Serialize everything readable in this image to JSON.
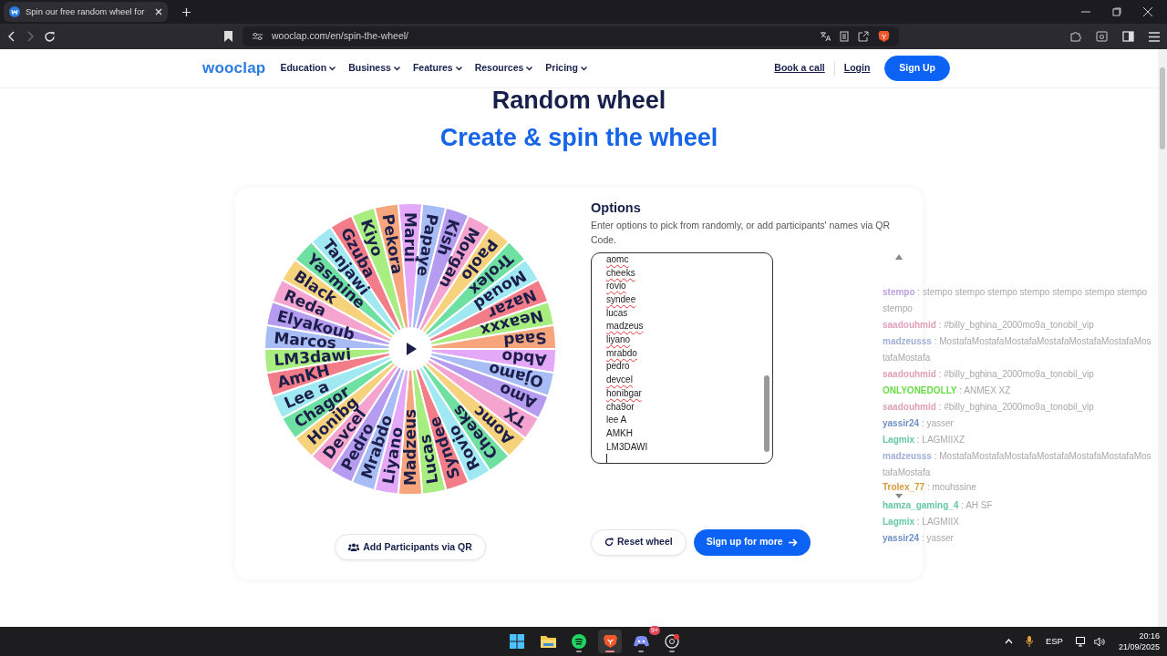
{
  "browser": {
    "tab_title": "Spin our free random wheel for",
    "url": "wooclap.com/en/spin-the-wheel/"
  },
  "site_nav": {
    "logo": "wooclap",
    "menu": [
      {
        "label": "Education"
      },
      {
        "label": "Business"
      },
      {
        "label": "Features"
      },
      {
        "label": "Resources"
      },
      {
        "label": "Pricing"
      }
    ],
    "book_call": "Book a call",
    "login": "Login",
    "signup": "Sign Up"
  },
  "hero": {
    "title": "Random wheel",
    "subtitle": "Create & spin the wheel"
  },
  "wheel": {
    "segments": [
      {
        "label": "Marui"
      },
      {
        "label": "Papaye"
      },
      {
        "label": "Kish"
      },
      {
        "label": "Morgan"
      },
      {
        "label": "Paolo"
      },
      {
        "label": "Trolex"
      },
      {
        "label": "Mouad"
      },
      {
        "label": "Nazar"
      },
      {
        "label": "Neaxxx"
      },
      {
        "label": "Saad"
      },
      {
        "label": "Abdo"
      },
      {
        "label": "Ojamo"
      },
      {
        "label": "Amo"
      },
      {
        "label": "TX"
      },
      {
        "label": "Aomc"
      },
      {
        "label": "Cheeks"
      },
      {
        "label": "Rovio"
      },
      {
        "label": "Syndee"
      },
      {
        "label": "Lucas"
      },
      {
        "label": "Madzeus"
      },
      {
        "label": "Liyano"
      },
      {
        "label": "Mrabdo"
      },
      {
        "label": "Pedro"
      },
      {
        "label": "Devcel"
      },
      {
        "label": "Honibg"
      },
      {
        "label": "Chagor"
      },
      {
        "label": "Lee a"
      },
      {
        "label": "AmKH"
      },
      {
        "label": "LM3dawi"
      },
      {
        "label": "Marcos"
      },
      {
        "label": "Elyakoub"
      },
      {
        "label": "Reda"
      },
      {
        "label": "Black"
      },
      {
        "label": "Yasmine"
      },
      {
        "label": "Tanjawi"
      },
      {
        "label": "Gzuba"
      },
      {
        "label": "Kiyo"
      },
      {
        "label": "Pekora"
      }
    ]
  },
  "options": {
    "title": "Options",
    "description": "Enter options to pick from randomly, or add participants' names via QR Code.",
    "entries": [
      {
        "text": "aomc",
        "misspelled": true
      },
      {
        "text": "cheeks",
        "misspelled": true
      },
      {
        "text": "rovio",
        "misspelled": true
      },
      {
        "text": "syndee",
        "misspelled": true
      },
      {
        "text": "lucas",
        "misspelled": false
      },
      {
        "text": "madzeus",
        "misspelled": true
      },
      {
        "text": "liyano",
        "misspelled": true
      },
      {
        "text": "mrabdo",
        "misspelled": true
      },
      {
        "text": "pedro",
        "misspelled": false
      },
      {
        "text": "devcel",
        "misspelled": true
      },
      {
        "text": "honibgar",
        "misspelled": true
      },
      {
        "text": "cha9or",
        "misspelled": false
      },
      {
        "text": "lee A",
        "misspelled": false
      },
      {
        "text": "AMKH",
        "misspelled": false
      },
      {
        "text": "LM3DAWI",
        "misspelled": false
      }
    ]
  },
  "buttons": {
    "add_qr": "Add Participants via QR",
    "reset": "Reset wheel",
    "signup_more": "Sign up for more"
  },
  "chat": [
    {
      "user": "stempo",
      "color": "#b9a0e0",
      "message": ": stempo stempo stempo stempo stempo stempo stempo stempo"
    },
    {
      "user": "saadouhmid",
      "color": "#e0a0b8",
      "message": ": #billy_bghina_2000mo9a_tonobil_vip"
    },
    {
      "user": "madzeusss",
      "color": "#9fb0d8",
      "message": ": MostafaMostafaMostafaMostafaMostafaMostafaMostafaMostafa"
    },
    {
      "user": "saadouhmid",
      "color": "#e0a0b8",
      "message": ": #billy_bghina_2000mo9a_tonobil_vip"
    },
    {
      "user": "ONLYONEDOLLY",
      "color": "#66dd44",
      "message": ": ANMEX XZ"
    },
    {
      "user": "saadouhmid",
      "color": "#e0a0b8",
      "message": ": #billy_bghina_2000mo9a_tonobil_vip"
    },
    {
      "user": "yassir24",
      "color": "#6f90c8",
      "message": ": yasser"
    },
    {
      "user": "Lagmix",
      "color": "#66c8a8",
      "message": ": LAGMIIXZ"
    },
    {
      "user": "madzeusss",
      "color": "#9fb0d8",
      "message": ": MostafaMostafaMostafaMostafaMostafaMostafaMostafaMostafa"
    },
    {
      "user": "Trolex_77",
      "color": "#d89a3a",
      "message": ": mouhssine"
    },
    {
      "user": "hamza_gaming_4",
      "color": "#66c8a8",
      "message": ": AH SF"
    },
    {
      "user": "Lagmix",
      "color": "#66c8a8",
      "message": ": LAGMIIX"
    },
    {
      "user": "yassir24",
      "color": "#6f90c8",
      "message": ": yasser"
    }
  ],
  "taskbar": {
    "apps": [
      {
        "kind": "start",
        "running": false,
        "selected": false
      },
      {
        "kind": "folder",
        "running": false,
        "selected": false
      },
      {
        "kind": "music",
        "running": true,
        "selected": false
      },
      {
        "kind": "lion",
        "running": true,
        "selected": true
      },
      {
        "kind": "chat",
        "running": true,
        "selected": false,
        "badge": "9+"
      },
      {
        "kind": "record",
        "running": true,
        "selected": false
      }
    ],
    "language": "ESP",
    "time": "20:16",
    "date": "21/09/2025"
  }
}
